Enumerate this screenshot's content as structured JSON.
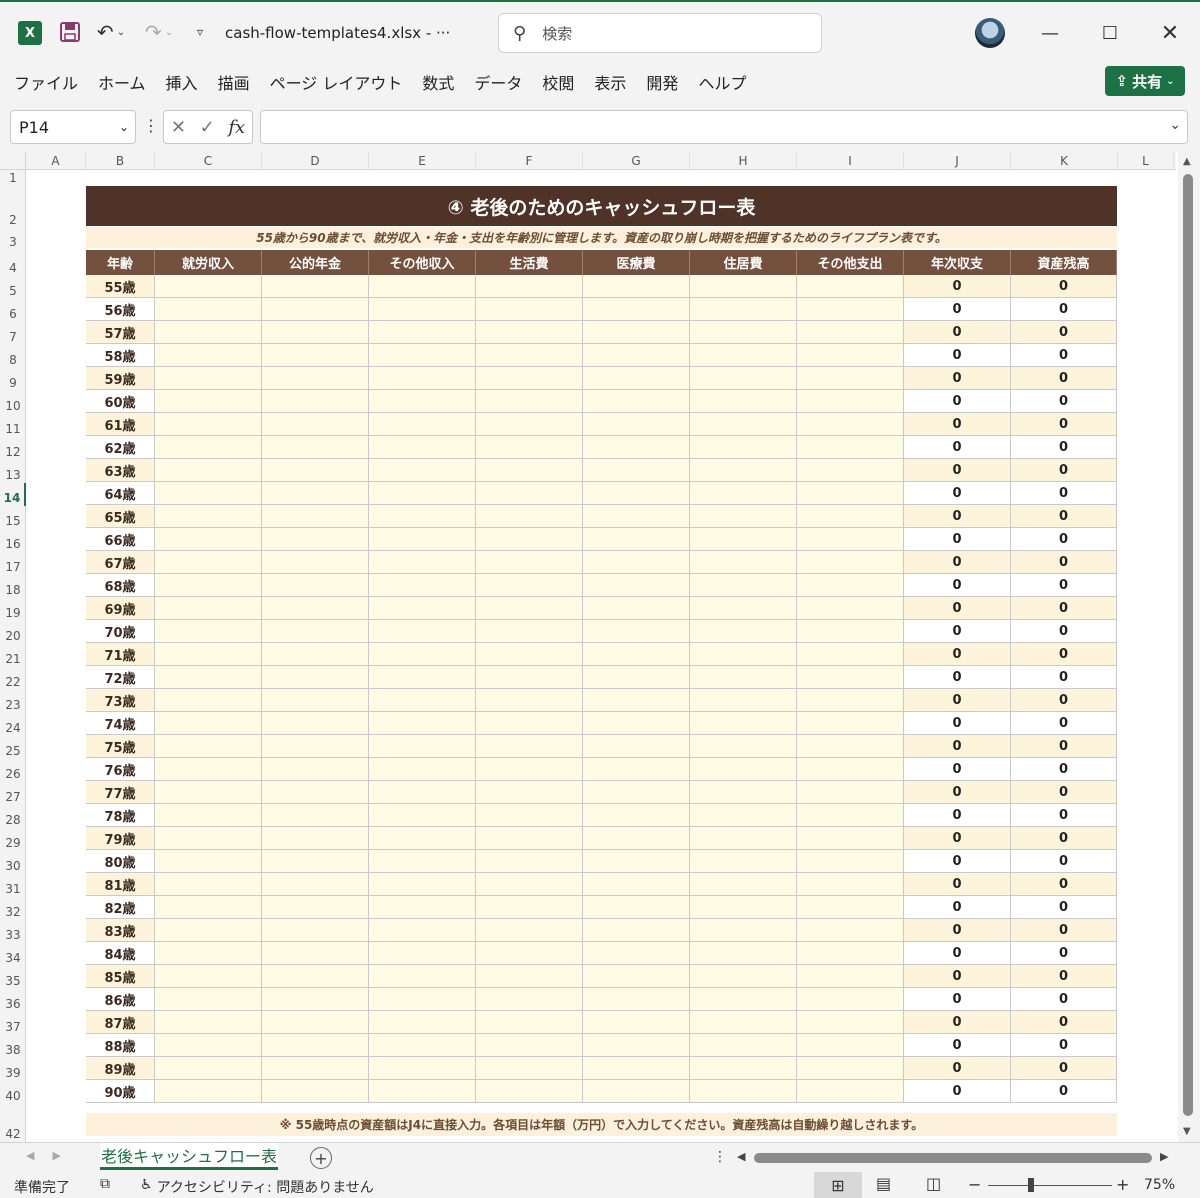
{
  "titlebar": {
    "app_icon": "X",
    "file_title": "cash-flow-templates4.xlsx  -  ···",
    "search_placeholder": "検索"
  },
  "ribbon": {
    "tabs": [
      "ファイル",
      "ホーム",
      "挿入",
      "描画",
      "ページ レイアウト",
      "数式",
      "データ",
      "校閲",
      "表示",
      "開発",
      "ヘルプ"
    ],
    "share_label": "共有"
  },
  "formula_bar": {
    "name_box": "P14",
    "formula": ""
  },
  "grid": {
    "columns": [
      "A",
      "B",
      "C",
      "D",
      "E",
      "F",
      "G",
      "H",
      "I",
      "J",
      "K",
      "L"
    ],
    "rows": [
      "1",
      "2",
      "3",
      "4",
      "5",
      "6",
      "7",
      "8",
      "9",
      "10",
      "11",
      "12",
      "13",
      "14",
      "15",
      "16",
      "17",
      "18",
      "19",
      "20",
      "21",
      "22",
      "23",
      "24",
      "25",
      "26",
      "27",
      "28",
      "29",
      "30",
      "31",
      "32",
      "33",
      "34",
      "35",
      "36",
      "37",
      "38",
      "39",
      "40",
      "42"
    ],
    "selected_row": "14"
  },
  "table": {
    "title": "④ 老後のためのキャッシュフロー表",
    "subtitle": "55歳から90歳まで、就労収入・年金・支出を年齢別に管理します。資産の取り崩し時期を把握するためのライフプラン表です。",
    "headers": [
      "年齢",
      "就労収入",
      "公的年金",
      "その他収入",
      "生活費",
      "医療費",
      "住居費",
      "その他支出",
      "年次収支",
      "資産残高"
    ],
    "ages": [
      "55歳",
      "56歳",
      "57歳",
      "58歳",
      "59歳",
      "60歳",
      "61歳",
      "62歳",
      "63歳",
      "64歳",
      "65歳",
      "66歳",
      "67歳",
      "68歳",
      "69歳",
      "70歳",
      "71歳",
      "72歳",
      "73歳",
      "74歳",
      "75歳",
      "76歳",
      "77歳",
      "78歳",
      "79歳",
      "80歳",
      "81歳",
      "82歳",
      "83歳",
      "84歳",
      "85歳",
      "86歳",
      "87歳",
      "88歳",
      "89歳",
      "90歳"
    ],
    "annual_balance": "0",
    "asset_balance": "0",
    "footnote": "※ 55歳時点の資産額はJ4に直接入力。各項目は年額（万円）で入力してください。資産残高は自動繰り越しされます。"
  },
  "sheet_tabs": {
    "active": "老後キャッシュフロー表"
  },
  "status": {
    "ready": "準備完了",
    "accessibility": "アクセシビリティ: 問題ありません",
    "zoom": "75%"
  },
  "colors": {
    "excel_green": "#1e7145",
    "title_band": "#4f3228",
    "header_row": "#74503f",
    "input_fill": "#fffbe5",
    "band_fill": "#fef4dc"
  }
}
